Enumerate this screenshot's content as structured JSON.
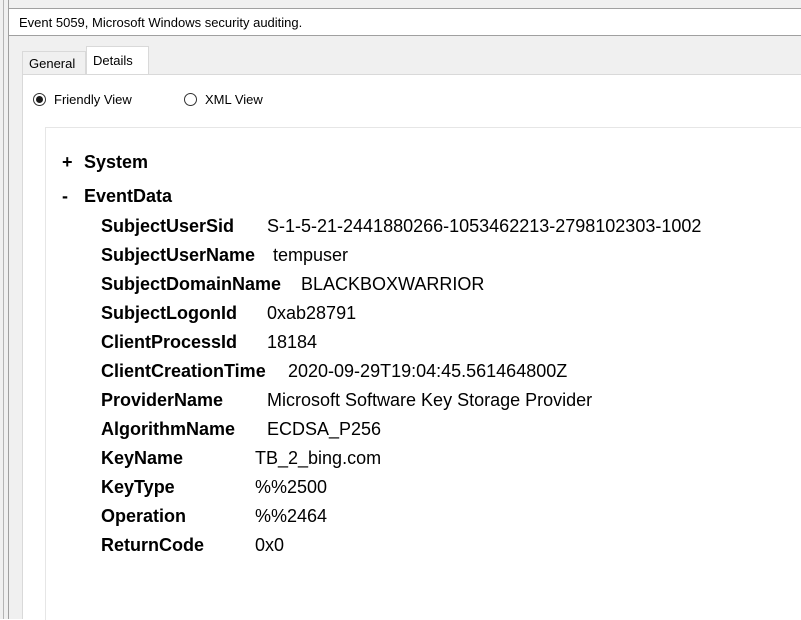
{
  "window": {
    "title": "Event 5059, Microsoft Windows security auditing."
  },
  "tabs": [
    {
      "label": "General",
      "active": false
    },
    {
      "label": "Details",
      "active": true
    }
  ],
  "view_options": {
    "friendly": {
      "label": "Friendly View",
      "selected": true
    },
    "xml": {
      "label": "XML View",
      "selected": false
    }
  },
  "tree": {
    "system": {
      "toggle": "+",
      "label": "System"
    },
    "event_data": {
      "toggle": "-",
      "label": "EventData"
    },
    "fields": [
      {
        "key": "SubjectUserSid",
        "value": "S-1-5-21-2441880266-1053462213-2798102303-1002"
      },
      {
        "key": "SubjectUserName",
        "value": "tempuser"
      },
      {
        "key": "SubjectDomainName",
        "value": "BLACKBOXWARRIOR"
      },
      {
        "key": "SubjectLogonId",
        "value": "0xab28791"
      },
      {
        "key": "ClientProcessId",
        "value": "18184"
      },
      {
        "key": "ClientCreationTime",
        "value": "2020-09-29T19:04:45.561464800Z"
      },
      {
        "key": "ProviderName",
        "value": "Microsoft Software Key Storage Provider"
      },
      {
        "key": "AlgorithmName",
        "value": "ECDSA_P256"
      },
      {
        "key": "KeyName",
        "value": "TB_2_bing.com"
      },
      {
        "key": "KeyType",
        "value": "%%2500"
      },
      {
        "key": "Operation",
        "value": "%%2464"
      },
      {
        "key": "ReturnCode",
        "value": "0x0"
      }
    ]
  }
}
